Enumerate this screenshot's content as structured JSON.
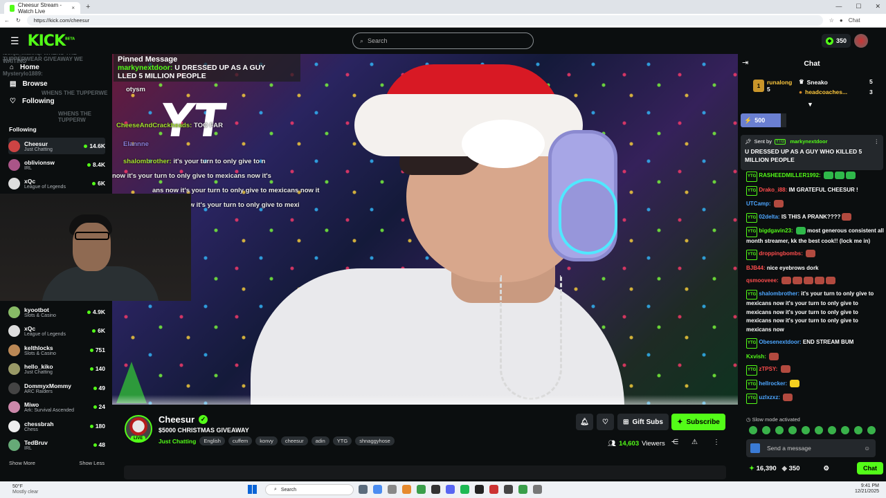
{
  "browser": {
    "tab_title": "Cheesur Stream - Watch Live",
    "url": "https://kick.com/cheesur",
    "chat_label": "Chat"
  },
  "header": {
    "logo": "KICK",
    "logo_sup": "BETA",
    "search_placeholder": "Search",
    "points": "350"
  },
  "sidebar": {
    "nav": [
      "Home",
      "Browse",
      "Following"
    ],
    "section": "Following",
    "channels_top": [
      {
        "name": "Cheesur",
        "category": "Just Chatting",
        "viewers": "14.6K"
      },
      {
        "name": "oblivionsw",
        "category": "IRL",
        "viewers": "8.4K"
      },
      {
        "name": "xQc",
        "category": "League of Legends",
        "viewers": "6K"
      }
    ],
    "channels_bottom": [
      {
        "name": "kyootbot",
        "category": "Slots & Casino",
        "viewers": "4.9K"
      },
      {
        "name": "xQc",
        "category": "League of Legends",
        "viewers": "6K"
      },
      {
        "name": "kelthlocks",
        "category": "Slots & Casino",
        "viewers": "751"
      },
      {
        "name": "hello_kiko",
        "category": "Just Chatting",
        "viewers": "140"
      },
      {
        "name": "DommyxMommy",
        "category": "ARC Raiders",
        "viewers": "49"
      },
      {
        "name": "Miwo",
        "category": "Ark: Survival Ascended",
        "viewers": "24"
      },
      {
        "name": "chessbrah",
        "category": "Chess",
        "viewers": "180"
      },
      {
        "name": "TedBruv",
        "category": "IRL",
        "viewers": "48"
      }
    ],
    "show_more": "Show More",
    "show_less": "Show Less",
    "ghost_lines": [
      "l3enja_manriq: WHENS THE TUPPERWEAR GIVEAWAY WE",
      "WAITING",
      "Mysterylo1889:",
      "WHENS THE TUPPERWE",
      "WHENS THE TUPPERW"
    ]
  },
  "video": {
    "pinned_title": "Pinned Message",
    "pinned_user": "markynextdoor:",
    "pinned_text_1": "U DRESSED UP AS A GUY",
    "pinned_text_2": "LLED 5 MILLION PEOPLE",
    "overlay_lines": [
      {
        "user": "",
        "text": "otysm"
      },
      {
        "user": "CheeseAndCrackheads:",
        "text": "TOO FAR"
      },
      {
        "user": "",
        "text": "Elannne"
      },
      {
        "user": "shalombrother:",
        "text": "it's your turn to only give to n"
      },
      {
        "user": "",
        "text": "now it's your turn to only give to mexicans now it's"
      },
      {
        "user": "",
        "text": "ans now it's your turn to only give to mexicans now it"
      },
      {
        "user": "",
        "text": "now it's your turn to only give to mexi"
      }
    ],
    "overlay_big": "YT"
  },
  "stream": {
    "name": "Cheesur",
    "live": "LIVE",
    "title": "$5000 CHRISTMAS GIVEAWAY",
    "category": "Just Chatting",
    "tags": [
      "English",
      "cuffem",
      "konvy",
      "cheesur",
      "adin",
      "YTG",
      "shnaggyhose"
    ],
    "gift_subs": "Gift Subs",
    "subscribe": "Subscribe",
    "viewers": "14,603",
    "viewers_label": "Viewers"
  },
  "chat": {
    "title": "Chat",
    "gifters": [
      {
        "name": "runalong",
        "count": "5"
      },
      {
        "name": "Sneako",
        "count": "5"
      },
      {
        "name": "headcoaches...",
        "count": "3"
      }
    ],
    "goal": "500",
    "pinned_by_label": "Sent by",
    "pinned_by_user": "markynextdoor",
    "pinned_text": "U DRESSED UP AS A GUY WHO KILLED 5 MILLION PEOPLE",
    "messages": [
      {
        "user": "RASHEEDMILLER1992:",
        "color": "#53fc18",
        "text": ""
      },
      {
        "user": "Drako_i88:",
        "color": "#ff4d4d",
        "text": "IM GRATEFUL CHEESUR !"
      },
      {
        "user": "UTCamp:",
        "color": "#4da6ff",
        "text": ""
      },
      {
        "user": "02delta:",
        "color": "#4da6ff",
        "text": "IS THIS A PRANK????"
      },
      {
        "user": "bigdgavin23:",
        "color": "#53fc18",
        "text": "most generous consistent all month streamer, kk the best cook!! (lock me in)"
      },
      {
        "user": "droppingbombs:",
        "color": "#ff4d4d",
        "text": ""
      },
      {
        "user": "BJB44:",
        "color": "#ff4d4d",
        "text": "nice eyebrows dork"
      },
      {
        "user": "qsmooveee:",
        "color": "#ff4d4d",
        "text": ""
      },
      {
        "user": "shalombrother:",
        "color": "#4da6ff",
        "text": "it's your turn to only give to mexicans now it's your turn to only give to mexicans now it's your turn to only give to mexicans now it's your turn to only give to mexicans now"
      },
      {
        "user": "Obesenextdoor:",
        "color": "#4da6ff",
        "text": "END STREAM BUM"
      },
      {
        "user": "Kxvish:",
        "color": "#53fc18",
        "text": ""
      },
      {
        "user": "zTPSY:",
        "color": "#ff4d4d",
        "text": ""
      },
      {
        "user": "hellrocker:",
        "color": "#4da6ff",
        "text": ""
      },
      {
        "user": "uzlxzxz:",
        "color": "#4da6ff",
        "text": ""
      }
    ],
    "slow_mode": "Slow mode activated",
    "input_placeholder": "Send a message",
    "balance": "16,390",
    "points": "350",
    "chat_button": "Chat"
  },
  "taskbar": {
    "temp": "50°F",
    "weather": "Mostly clear",
    "search": "Search",
    "time": "9:41 PM",
    "date": "12/21/2025"
  }
}
